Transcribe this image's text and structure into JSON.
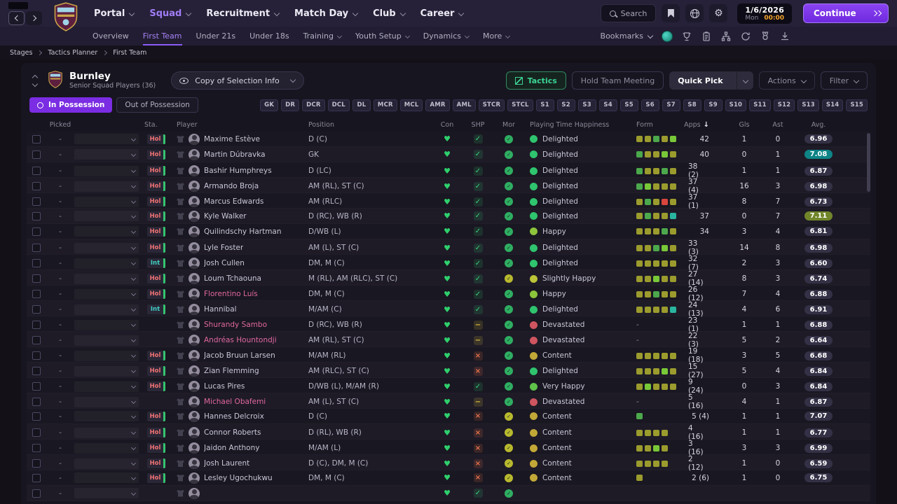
{
  "topbar": {
    "menus": [
      {
        "label": "Portal",
        "active": false
      },
      {
        "label": "Squad",
        "active": true
      },
      {
        "label": "Recruitment",
        "active": false
      },
      {
        "label": "Match Day",
        "active": false
      },
      {
        "label": "Club",
        "active": false
      },
      {
        "label": "Career",
        "active": false
      }
    ],
    "search_label": "Search",
    "date": "1/6/2026",
    "day": "Mon",
    "time": "00:00",
    "continue_label": "Continue"
  },
  "subnav": {
    "items": [
      {
        "label": "Overview",
        "active": false,
        "chevron": false
      },
      {
        "label": "First Team",
        "active": true,
        "chevron": false
      },
      {
        "label": "Under 21s",
        "active": false,
        "chevron": false
      },
      {
        "label": "Under 18s",
        "active": false,
        "chevron": false
      },
      {
        "label": "Training",
        "active": false,
        "chevron": true
      },
      {
        "label": "Youth Setup",
        "active": false,
        "chevron": true
      },
      {
        "label": "Dynamics",
        "active": false,
        "chevron": true
      },
      {
        "label": "More",
        "active": false,
        "chevron": true
      }
    ],
    "bookmarks_label": "Bookmarks"
  },
  "breadcrumb": [
    "Stages",
    "Tactics Planner",
    "First Team"
  ],
  "squad_header": {
    "club_name": "Burnley",
    "subtitle": "Senior Squad Players (36)",
    "view_selector": "Copy of Selection Info",
    "tactics_button": "Tactics",
    "meeting_button": "Hold Team Meeting",
    "quick_pick_button": "Quick Pick",
    "actions_button": "Actions",
    "filter_button": "Filter"
  },
  "possession": {
    "in_label": "In Possession",
    "out_label": "Out of Possession"
  },
  "position_slots": [
    "GK",
    "DR",
    "DCR",
    "DCL",
    "DL",
    "MCR",
    "MCL",
    "AMR",
    "AML",
    "STCR",
    "STCL",
    "S1",
    "S2",
    "S3",
    "S4",
    "S5",
    "S6",
    "S7",
    "S8",
    "S9",
    "S10",
    "S11",
    "S12",
    "S13",
    "S14",
    "S15"
  ],
  "table": {
    "headers": {
      "picked": "Picked",
      "sta": "Sta.",
      "player": "Player",
      "position": "Position",
      "con": "Con",
      "shp": "SHP",
      "mor": "Mor",
      "happiness": "Playing Time Happiness",
      "form": "Form",
      "apps": "Apps",
      "gls": "Gls",
      "ast": "Ast",
      "avg": "Avg."
    },
    "sort_column": "Apps",
    "form_colors": {
      "olive": "#9b9b2e",
      "green": "#4ca84c",
      "bright": "#78c838",
      "red": "#d9463e",
      "teal": "#2ab5a0"
    },
    "happiness_colors": {
      "Delighted": "#2fc46e",
      "Very Happy": "#5fc24a",
      "Happy": "#8cc43c",
      "Slightly Happy": "#bcc437",
      "Content": "#c2a837",
      "Devastated": "#cf5560"
    },
    "rows": [
      {
        "picked": "-",
        "tag": "Hol",
        "name": "Maxime Estève",
        "loan": false,
        "position": "D (C)",
        "shp": "check",
        "mor": "green",
        "happiness": "Delighted",
        "form": [
          "olive",
          "olive",
          "green",
          "olive",
          "bright"
        ],
        "apps": "42",
        "gls": "1",
        "ast": "0",
        "avg": "6.96",
        "avg_style": "default"
      },
      {
        "picked": "-",
        "tag": "Hol",
        "name": "Martin Dúbravka",
        "loan": false,
        "position": "GK",
        "shp": "check",
        "mor": "green",
        "happiness": "Delighted",
        "form": [
          "green",
          "olive",
          "olive",
          "bright",
          "olive"
        ],
        "apps": "40",
        "gls": "0",
        "ast": "1",
        "avg": "7.08",
        "avg_style": "teal"
      },
      {
        "picked": "-",
        "tag": "Hol",
        "name": "Bashir Humphreys",
        "loan": false,
        "position": "D (LC)",
        "shp": "check",
        "mor": "green",
        "happiness": "Delighted",
        "form": [
          "green",
          "olive",
          "olive",
          "green",
          "olive"
        ],
        "apps": "38 (2)",
        "gls": "1",
        "ast": "1",
        "avg": "6.87",
        "avg_style": "default"
      },
      {
        "picked": "-",
        "tag": "Hol",
        "name": "Armando Broja",
        "loan": false,
        "position": "AM (RL), ST (C)",
        "shp": "check",
        "mor": "green",
        "happiness": "Delighted",
        "form": [
          "green",
          "bright",
          "olive",
          "olive",
          "olive"
        ],
        "apps": "37 (4)",
        "gls": "16",
        "ast": "3",
        "avg": "6.98",
        "avg_style": "default"
      },
      {
        "picked": "-",
        "tag": "Hol",
        "name": "Marcus Edwards",
        "loan": false,
        "position": "AM (RLC)",
        "shp": "check",
        "mor": "green",
        "happiness": "Delighted",
        "form": [
          "olive",
          "green",
          "olive",
          "red",
          "olive"
        ],
        "apps": "37 (1)",
        "gls": "8",
        "ast": "7",
        "avg": "6.73",
        "avg_style": "default"
      },
      {
        "picked": "-",
        "tag": "Hol",
        "name": "Kyle Walker",
        "loan": false,
        "position": "D (RC), WB (R)",
        "shp": "check",
        "mor": "green",
        "happiness": "Delighted",
        "form": [
          "olive",
          "green",
          "olive",
          "olive",
          "teal"
        ],
        "apps": "37",
        "gls": "0",
        "ast": "7",
        "avg": "7.11",
        "avg_style": "green"
      },
      {
        "picked": "-",
        "tag": "Hol",
        "name": "Quilindschy Hartman",
        "loan": false,
        "position": "D/WB (L)",
        "shp": "check",
        "mor": "green",
        "happiness": "Happy",
        "form": [
          "olive",
          "olive",
          "olive",
          "green",
          "olive"
        ],
        "apps": "34",
        "gls": "3",
        "ast": "4",
        "avg": "6.81",
        "avg_style": "default"
      },
      {
        "picked": "-",
        "tag": "Hol",
        "name": "Lyle Foster",
        "loan": false,
        "position": "AM (L), ST (C)",
        "shp": "check",
        "mor": "green",
        "happiness": "Delighted",
        "form": [
          "olive",
          "olive",
          "green",
          "bright",
          "olive"
        ],
        "apps": "33 (3)",
        "gls": "14",
        "ast": "8",
        "avg": "6.98",
        "avg_style": "default"
      },
      {
        "picked": "-",
        "tag": "Int",
        "name": "Josh Cullen",
        "loan": false,
        "position": "DM, M (C)",
        "shp": "check",
        "mor": "green",
        "happiness": "Delighted",
        "form": [
          "olive",
          "olive",
          "olive",
          "olive",
          "olive"
        ],
        "apps": "32 (7)",
        "gls": "2",
        "ast": "3",
        "avg": "6.60",
        "avg_style": "default"
      },
      {
        "picked": "-",
        "tag": "Hol",
        "name": "Loum Tchaouna",
        "loan": false,
        "position": "M (RL), AM (RLC), ST (C)",
        "shp": "check",
        "mor": "yellow",
        "happiness": "Slightly Happy",
        "form": [
          "olive",
          "olive",
          "bright",
          "olive",
          "olive"
        ],
        "apps": "27 (14)",
        "gls": "8",
        "ast": "3",
        "avg": "6.74",
        "avg_style": "default"
      },
      {
        "picked": "-",
        "tag": "Hol",
        "name": "Florentino Luís",
        "loan": true,
        "position": "DM, M (C)",
        "shp": "check",
        "mor": "green",
        "happiness": "Happy",
        "form": [
          "olive",
          "olive",
          "green",
          "olive",
          "olive"
        ],
        "apps": "26 (12)",
        "gls": "7",
        "ast": "4",
        "avg": "6.88",
        "avg_style": "default"
      },
      {
        "picked": "-",
        "tag": "Int",
        "name": "Hannibal",
        "loan": false,
        "position": "M/AM (C)",
        "shp": "check",
        "mor": "green",
        "happiness": "Delighted",
        "form": [
          "olive",
          "olive",
          "olive",
          "olive",
          "teal"
        ],
        "apps": "24 (13)",
        "gls": "4",
        "ast": "6",
        "avg": "6.91",
        "avg_style": "default"
      },
      {
        "picked": "-",
        "tag": "",
        "name": "Shurandy Sambo",
        "loan": true,
        "position": "D (RC), WB (R)",
        "shp": "dash",
        "mor": "green",
        "happiness": "Devastated",
        "form": [],
        "apps": "23 (1)",
        "gls": "1",
        "ast": "1",
        "avg": "6.88",
        "avg_style": "default"
      },
      {
        "picked": "-",
        "tag": "",
        "name": "Andréas Hountondji",
        "loan": true,
        "position": "AM (RL), ST (C)",
        "shp": "dash",
        "mor": "green",
        "happiness": "Devastated",
        "form": [],
        "apps": "22 (3)",
        "gls": "5",
        "ast": "2",
        "avg": "6.64",
        "avg_style": "default"
      },
      {
        "picked": "-",
        "tag": "Hol",
        "name": "Jacob Bruun Larsen",
        "loan": false,
        "position": "M/AM (RL)",
        "shp": "cross",
        "mor": "green",
        "happiness": "Content",
        "form": [
          "olive",
          "olive",
          "olive",
          "olive",
          "olive"
        ],
        "apps": "19 (18)",
        "gls": "3",
        "ast": "5",
        "avg": "6.68",
        "avg_style": "default"
      },
      {
        "picked": "-",
        "tag": "Hol",
        "name": "Zian Flemming",
        "loan": false,
        "position": "AM (RLC), ST (C)",
        "shp": "cross",
        "mor": "green",
        "happiness": "Delighted",
        "form": [
          "olive",
          "olive",
          "olive",
          "bright",
          "olive"
        ],
        "apps": "15 (27)",
        "gls": "5",
        "ast": "4",
        "avg": "6.84",
        "avg_style": "default"
      },
      {
        "picked": "-",
        "tag": "Hol",
        "name": "Lucas Pires",
        "loan": false,
        "position": "D/WB (L), M/AM (R)",
        "shp": "check",
        "mor": "green",
        "happiness": "Very Happy",
        "form": [
          "olive",
          "bright",
          "olive",
          "olive",
          "olive"
        ],
        "apps": "9 (24)",
        "gls": "0",
        "ast": "3",
        "avg": "6.84",
        "avg_style": "default"
      },
      {
        "picked": "-",
        "tag": "",
        "name": "Michael Obafemi",
        "loan": true,
        "position": "AM (L), ST (C)",
        "shp": "dash",
        "mor": "green",
        "happiness": "Devastated",
        "form": [],
        "apps": "5 (16)",
        "gls": "4",
        "ast": "1",
        "avg": "6.87",
        "avg_style": "default"
      },
      {
        "picked": "-",
        "tag": "Hol",
        "name": "Hannes Delcroix",
        "loan": false,
        "position": "D (C)",
        "shp": "cross",
        "mor": "yellow",
        "happiness": "Content",
        "form": [
          "green"
        ],
        "apps": "5 (4)",
        "gls": "1",
        "ast": "1",
        "avg": "7.07",
        "avg_style": "default"
      },
      {
        "picked": "-",
        "tag": "Hol",
        "name": "Connor Roberts",
        "loan": false,
        "position": "D (RL), WB (R)",
        "shp": "cross",
        "mor": "yellow",
        "happiness": "Content",
        "form": [
          "olive",
          "olive",
          "olive",
          "olive"
        ],
        "apps": "4 (16)",
        "gls": "1",
        "ast": "1",
        "avg": "6.77",
        "avg_style": "default"
      },
      {
        "picked": "-",
        "tag": "Hol",
        "name": "Jaidon Anthony",
        "loan": false,
        "position": "M/AM (L)",
        "shp": "cross",
        "mor": "yellow",
        "happiness": "Content",
        "form": [
          "olive",
          "olive",
          "bright",
          "olive"
        ],
        "apps": "3 (16)",
        "gls": "3",
        "ast": "3",
        "avg": "6.99",
        "avg_style": "default"
      },
      {
        "picked": "-",
        "tag": "Hol",
        "name": "Josh Laurent",
        "loan": false,
        "position": "D (C), DM, M (C)",
        "shp": "cross",
        "mor": "yellow",
        "happiness": "Content",
        "form": [
          "olive",
          "olive",
          "olive",
          "olive"
        ],
        "apps": "2 (12)",
        "gls": "1",
        "ast": "0",
        "avg": "6.59",
        "avg_style": "default"
      },
      {
        "picked": "-",
        "tag": "Hol",
        "name": "Lesley Ugochukwu",
        "loan": false,
        "position": "DM, M (C)",
        "shp": "cross",
        "mor": "yellow",
        "happiness": "Content",
        "form": [
          "olive"
        ],
        "apps": "2 (6)",
        "gls": "1",
        "ast": "0",
        "avg": "6.75",
        "avg_style": "default"
      },
      {
        "picked": "-",
        "tag": "",
        "name": "",
        "loan": false,
        "position": "",
        "shp": "check",
        "mor": "green",
        "happiness": "",
        "form": null,
        "apps": "",
        "gls": "",
        "ast": "",
        "avg": "",
        "avg_style": ""
      }
    ]
  }
}
